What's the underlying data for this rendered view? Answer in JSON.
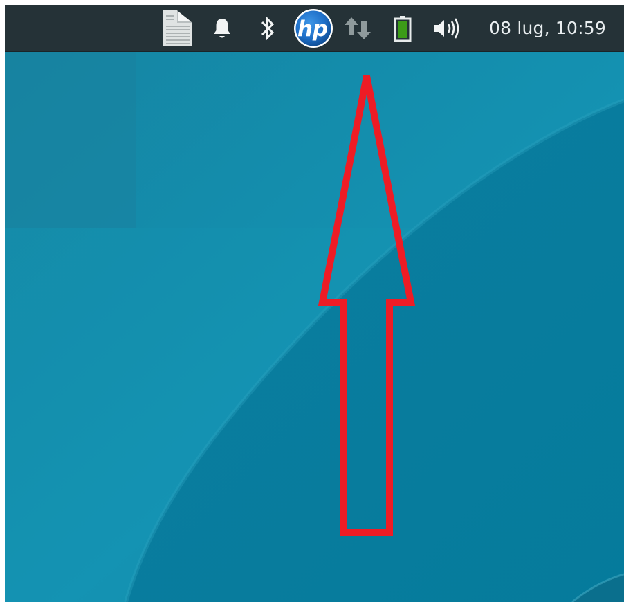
{
  "panel": {
    "clock_text": "08 lug, 10:59",
    "tray_icons": [
      "document-icon",
      "notification-bell-icon",
      "bluetooth-icon",
      "hp-logo-icon",
      "network-transfer-icon",
      "battery-icon",
      "volume-icon"
    ],
    "hp_logo_text": "hp"
  },
  "colors": {
    "panel_background": "#253237",
    "desktop_background": "#1287a6",
    "annotation_arrow": "#ee1c25",
    "battery_fill": "#3c9c18",
    "hp_blue": "#1f6fc8"
  },
  "annotation": {
    "shape": "arrow-up-outline",
    "points_to": "hp-logo-icon"
  }
}
